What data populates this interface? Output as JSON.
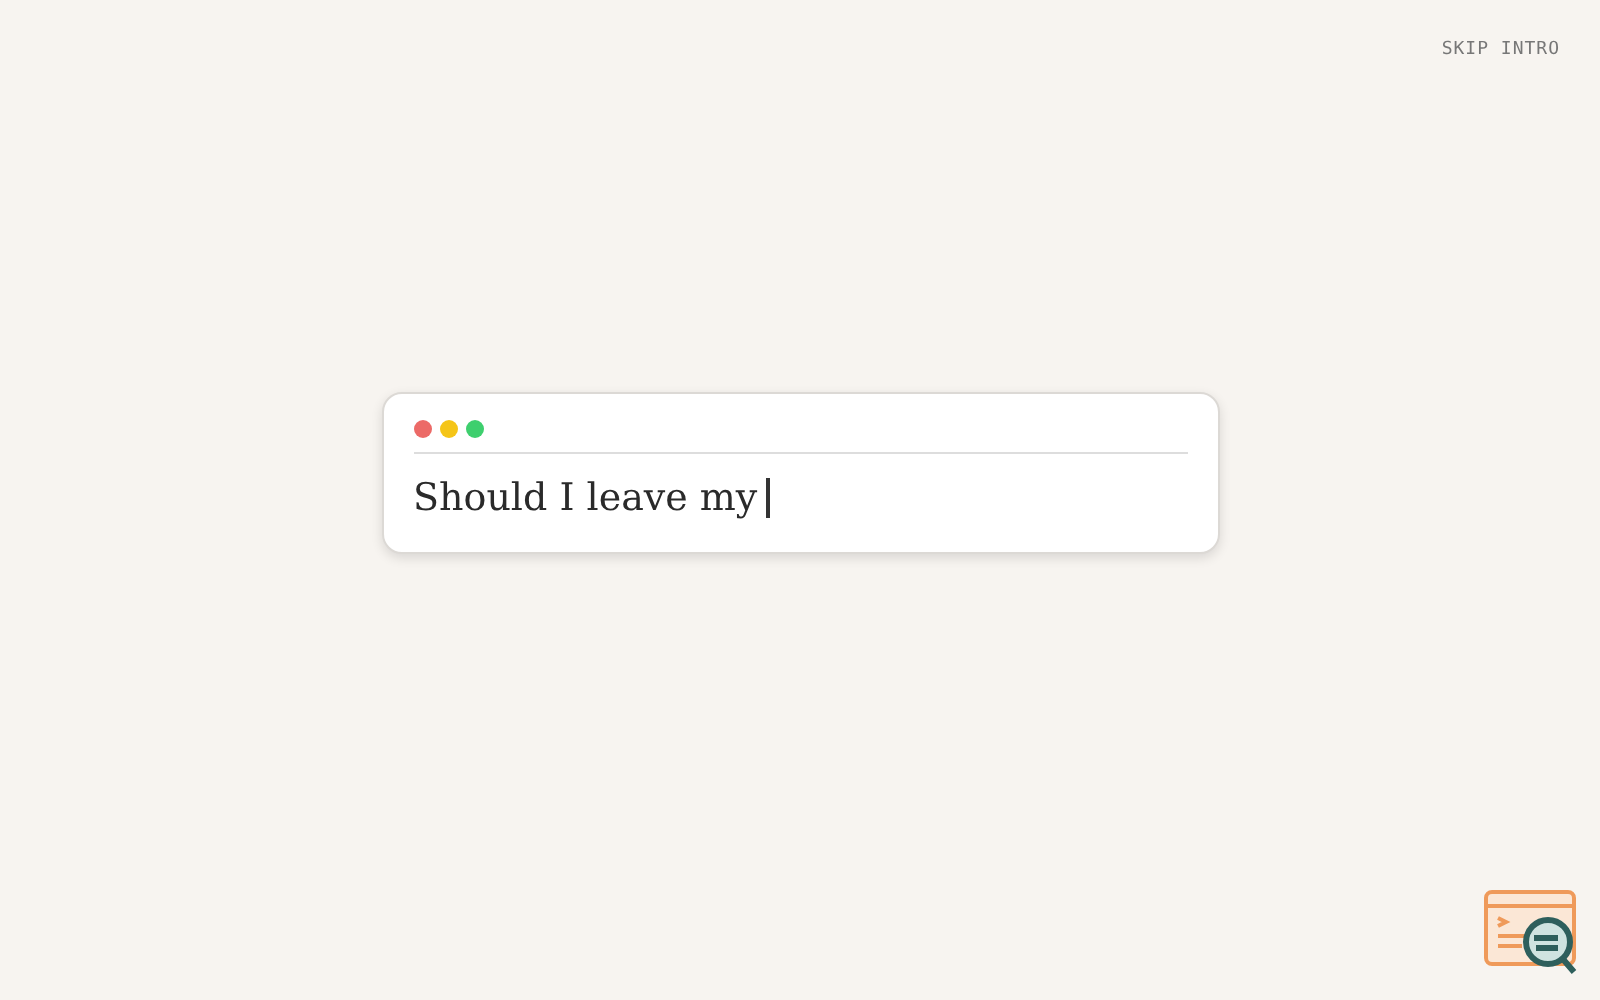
{
  "skip_link": "SKIP INTRO",
  "prompt_window": {
    "controls": [
      {
        "color": "#ec6a67"
      },
      {
        "color": "#f5c518"
      },
      {
        "color": "#3ecf6e"
      }
    ],
    "typed_text": "Should I leave my"
  }
}
